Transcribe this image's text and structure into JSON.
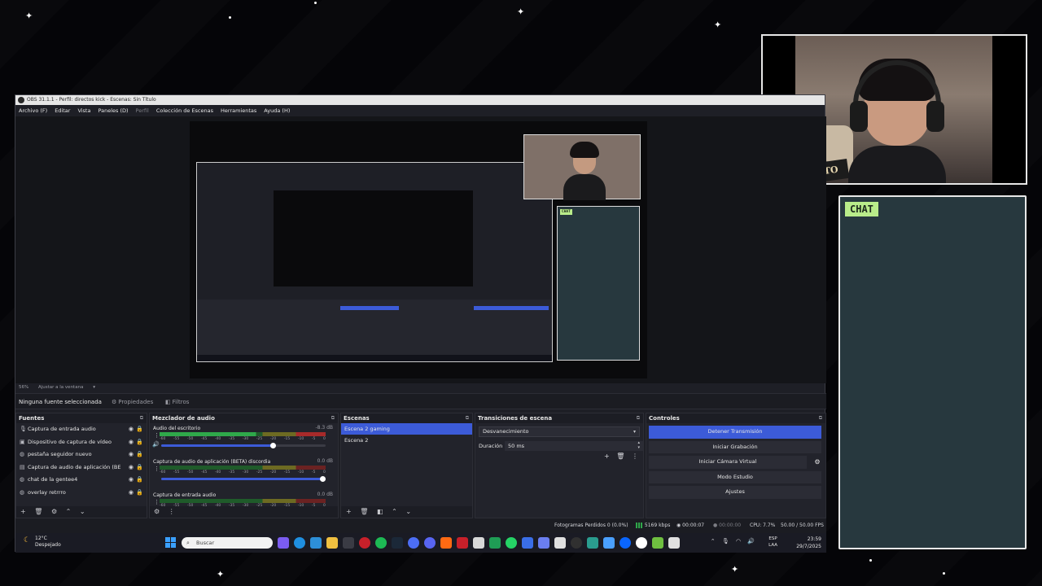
{
  "window": {
    "title": "OBS 31.1.1 - Perfil: directos kick - Escenas: Sin Título"
  },
  "menu": [
    {
      "label": "Archivo (F)",
      "enabled": true
    },
    {
      "label": "Editar",
      "enabled": true
    },
    {
      "label": "Vista",
      "enabled": true
    },
    {
      "label": "Paneles (D)",
      "enabled": true
    },
    {
      "label": "Perfil",
      "enabled": false
    },
    {
      "label": "Colección de Escenas",
      "enabled": true
    },
    {
      "label": "Herramientas",
      "enabled": true
    },
    {
      "label": "Ayuda (H)",
      "enabled": true
    }
  ],
  "preview": {
    "zoom": "56%",
    "fit": "Ajustar a la ventana",
    "chat_label": "CHAT"
  },
  "overlay": {
    "chat_label": "CHAT",
    "cam_sign": "PUTO LINDO"
  },
  "props_bar": {
    "no_source": "Ninguna fuente seleccionada",
    "properties": "Propiedades",
    "filters": "Filtros"
  },
  "sources": {
    "title": "Fuentes",
    "items": [
      {
        "name": "Captura de entrada audio",
        "icon": "microphone-icon"
      },
      {
        "name": "Dispositivo de captura de vídeo",
        "icon": "camera-icon"
      },
      {
        "name": "pestaña seguidor nuevo",
        "icon": "browser-icon"
      },
      {
        "name": "Captura de audio de aplicación (BE",
        "icon": "app-audio-icon"
      },
      {
        "name": "chat de la gentee4",
        "icon": "browser-icon"
      },
      {
        "name": "overlay retrrro",
        "icon": "browser-icon"
      }
    ]
  },
  "mixer": {
    "title": "Mezclador de audio",
    "ticks": [
      "-60",
      "-55",
      "-50",
      "-45",
      "-40",
      "-35",
      "-30",
      "-25",
      "-20",
      "-15",
      "-10",
      "-5",
      "0"
    ],
    "items": [
      {
        "name": "Audio del escritorio",
        "db": "-8.3 dB",
        "level": 0.7
      },
      {
        "name": "Captura de audio de aplicación (BETA) discordia",
        "db": "0.0 dB",
        "level": 1.0
      },
      {
        "name": "Captura de entrada audio",
        "db": "0.0 dB",
        "level": 1.0
      }
    ]
  },
  "scenes": {
    "title": "Escenas",
    "items": [
      {
        "name": "Escena 2 gaming",
        "selected": true
      },
      {
        "name": "Escena 2",
        "selected": false
      }
    ]
  },
  "transitions": {
    "title": "Transiciones de escena",
    "type": "Desvanecimiento",
    "duration_label": "Duración",
    "duration": "50 ms"
  },
  "controls": {
    "title": "Controles",
    "stop_stream": "Detener Transmisión",
    "start_recording": "Iniciar Grabación",
    "virtual_cam": "Iniciar Cámara Virtual",
    "studio_mode": "Modo Estudio",
    "settings": "Ajustes"
  },
  "status": {
    "dropped": "Fotogramas Perdidos 0 (0.0%)",
    "bitrate": "5169 kbps",
    "stream_time": "00:00:07",
    "rec_time": "00:00:00",
    "cpu": "CPU: 7.7%",
    "fps": "50.00 / 50.00 FPS"
  },
  "taskbar": {
    "temp": "12°C",
    "weather": "Despejado",
    "search": "Buscar",
    "lang1": "ESP",
    "lang2": "LAA",
    "time": "23:59",
    "date": "29/7/2025"
  },
  "colors": {
    "accent": "#3c5bd8",
    "chat_bg": "#27383e",
    "chat_tag": "#b9ec8a"
  }
}
